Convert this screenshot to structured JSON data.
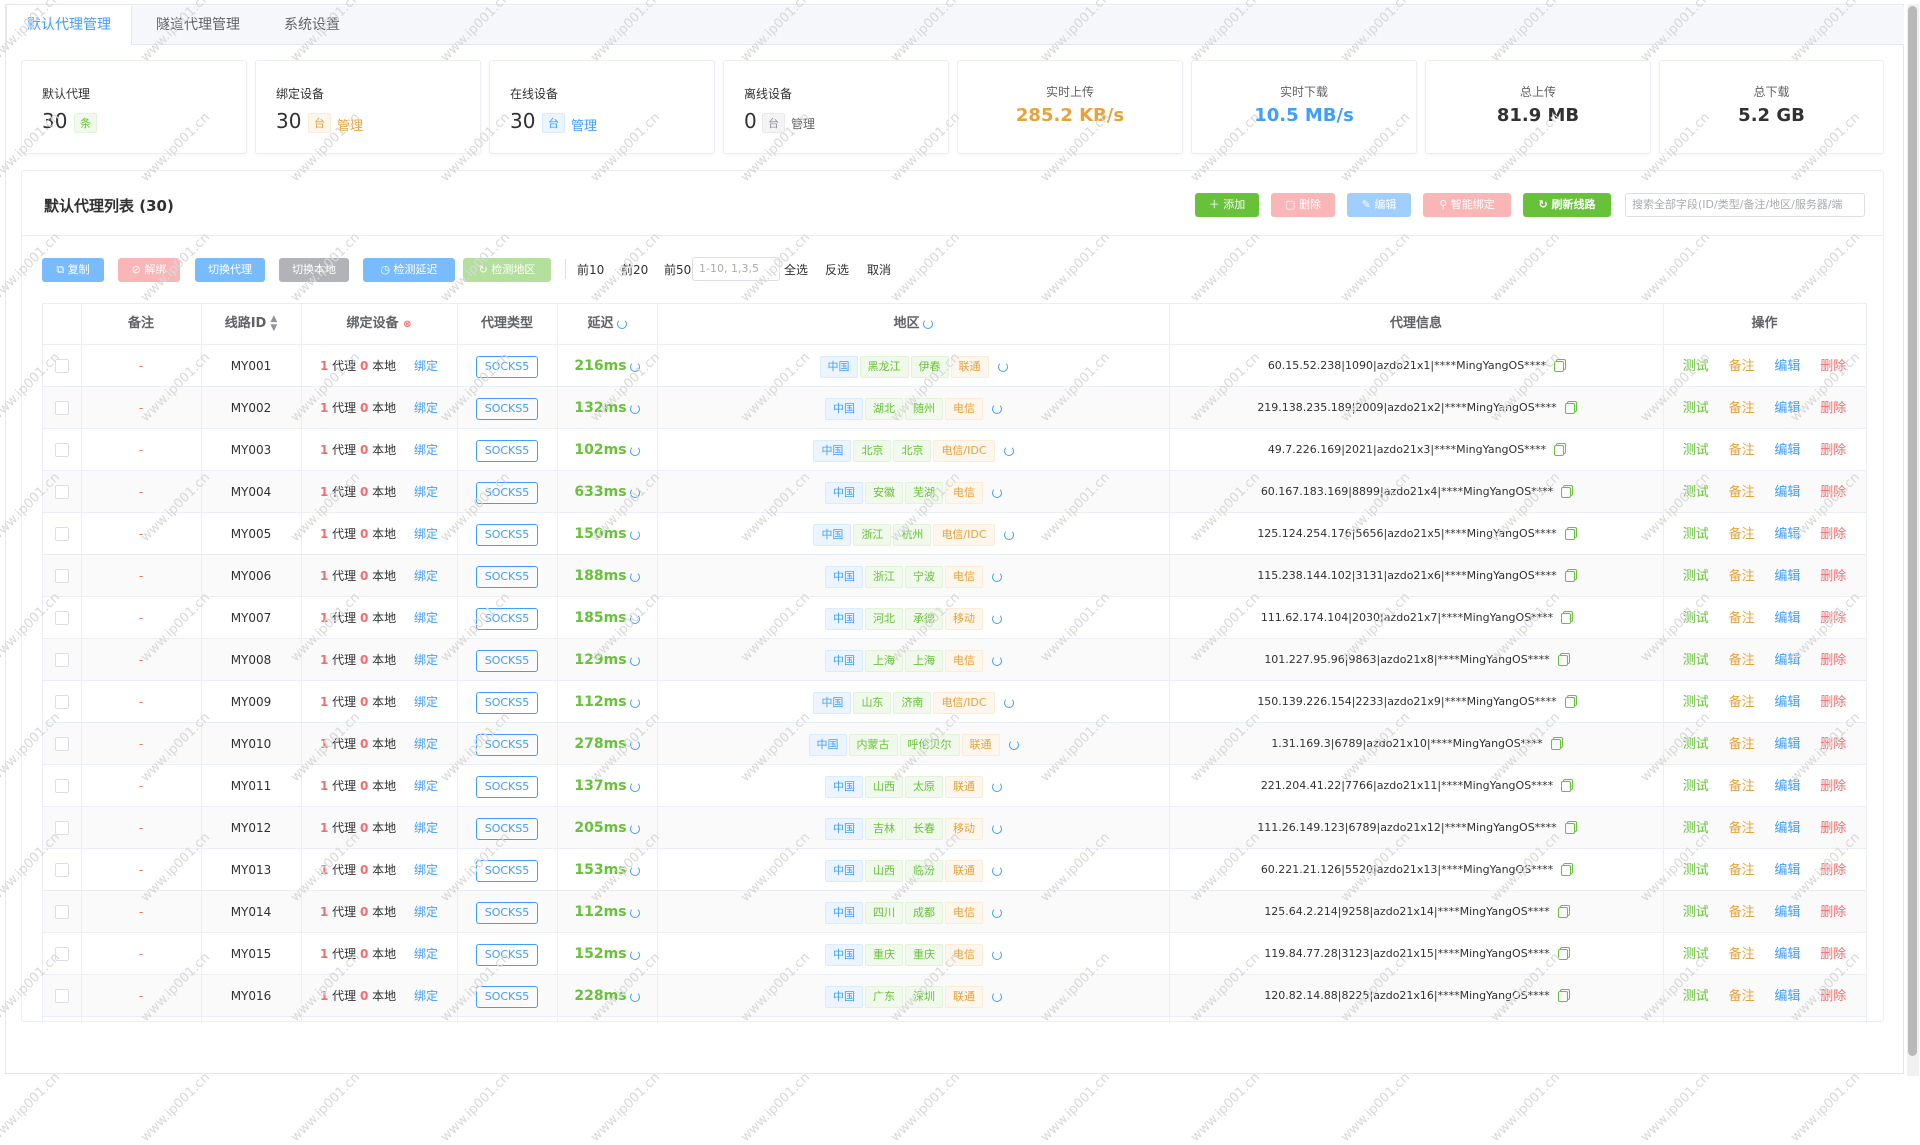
{
  "tabs": [
    "默认代理管理",
    "隧道代理管理",
    "系统设置"
  ],
  "stats": {
    "default_proxy": {
      "label": "默认代理",
      "value": "30",
      "unit": "条"
    },
    "bound_devices": {
      "label": "绑定设备",
      "value": "30",
      "unit": "台",
      "link": "管理"
    },
    "online_devices": {
      "label": "在线设备",
      "value": "30",
      "unit": "台",
      "link": "管理"
    },
    "offline_devices": {
      "label": "离线设备",
      "value": "0",
      "unit": "台",
      "link": "管理"
    },
    "upload_rate": {
      "label": "实时上传",
      "value": "285.2 KB/s",
      "color": "#e6a23c"
    },
    "download_rate": {
      "label": "实时下载",
      "value": "10.5 MB/s",
      "color": "#409eff"
    },
    "total_upload": {
      "label": "总上传",
      "value": "81.9 MB",
      "color": "#303133"
    },
    "total_download": {
      "label": "总下载",
      "value": "5.2 GB",
      "color": "#303133"
    }
  },
  "panel": {
    "title": "默认代理列表 (30)",
    "toolbar": {
      "add": "添加",
      "delete": "删除",
      "edit": "编辑",
      "smart_bind": "智能绑定",
      "refresh": "刷新线路"
    },
    "search_placeholder": "搜索全部字段(ID/类型/备注/地区/服务器/端",
    "actions": {
      "copy": "复制",
      "unbind": "解绑",
      "switch_proxy": "切换代理",
      "switch_local": "切换本地",
      "check_latency": "检测延迟",
      "check_region": "检测地区"
    },
    "quick": {
      "top10": "前10",
      "top20": "前20",
      "top50": "前50",
      "range_placeholder": "1-10, 1,3,5",
      "select_all": "全选",
      "invert": "反选",
      "cancel": "取消"
    }
  },
  "table": {
    "headers": {
      "remark": "备注",
      "line_id": "线路ID",
      "bound": "绑定设备",
      "type": "代理类型",
      "latency": "延迟",
      "region": "地区",
      "info": "代理信息",
      "ops": "操作"
    },
    "labels": {
      "proxy": "代理",
      "local": "本地",
      "bind": "绑定",
      "test": "测试",
      "note": "备注",
      "edit": "编辑",
      "delete": "删除"
    },
    "rows": [
      {
        "remark": "-",
        "id": "MY001",
        "proxy_n": "1",
        "local_n": "0",
        "type": "SOCKS5",
        "latency": "216ms",
        "region": [
          "中国",
          "黑龙江",
          "伊春",
          "联通"
        ],
        "info": "60.15.52.238|1090|azdo21x1|****MingYangOS****"
      },
      {
        "remark": "-",
        "id": "MY002",
        "proxy_n": "1",
        "local_n": "0",
        "type": "SOCKS5",
        "latency": "132ms",
        "region": [
          "中国",
          "湖北",
          "随州",
          "电信"
        ],
        "info": "219.138.235.189|2009|azdo21x2|****MingYangOS****"
      },
      {
        "remark": "-",
        "id": "MY003",
        "proxy_n": "1",
        "local_n": "0",
        "type": "SOCKS5",
        "latency": "102ms",
        "region": [
          "中国",
          "北京",
          "北京",
          "电信/IDC"
        ],
        "info": "49.7.226.169|2021|azdo21x3|****MingYangOS****"
      },
      {
        "remark": "-",
        "id": "MY004",
        "proxy_n": "1",
        "local_n": "0",
        "type": "SOCKS5",
        "latency": "633ms",
        "region": [
          "中国",
          "安徽",
          "芜湖",
          "电信"
        ],
        "info": "60.167.183.169|8899|azdo21x4|****MingYangOS****"
      },
      {
        "remark": "-",
        "id": "MY005",
        "proxy_n": "1",
        "local_n": "0",
        "type": "SOCKS5",
        "latency": "150ms",
        "region": [
          "中国",
          "浙江",
          "杭州",
          "电信/IDC"
        ],
        "info": "125.124.254.176|5656|azdo21x5|****MingYangOS****"
      },
      {
        "remark": "-",
        "id": "MY006",
        "proxy_n": "1",
        "local_n": "0",
        "type": "SOCKS5",
        "latency": "188ms",
        "region": [
          "中国",
          "浙江",
          "宁波",
          "电信"
        ],
        "info": "115.238.144.102|3131|azdo21x6|****MingYangOS****"
      },
      {
        "remark": "-",
        "id": "MY007",
        "proxy_n": "1",
        "local_n": "0",
        "type": "SOCKS5",
        "latency": "185ms",
        "region": [
          "中国",
          "河北",
          "承德",
          "移动"
        ],
        "info": "111.62.174.104|2030|azdo21x7|****MingYangOS****"
      },
      {
        "remark": "-",
        "id": "MY008",
        "proxy_n": "1",
        "local_n": "0",
        "type": "SOCKS5",
        "latency": "129ms",
        "region": [
          "中国",
          "上海",
          "上海",
          "电信"
        ],
        "info": "101.227.95.96|9863|azdo21x8|****MingYangOS****"
      },
      {
        "remark": "-",
        "id": "MY009",
        "proxy_n": "1",
        "local_n": "0",
        "type": "SOCKS5",
        "latency": "112ms",
        "region": [
          "中国",
          "山东",
          "济南",
          "电信/IDC"
        ],
        "info": "150.139.226.154|2233|azdo21x9|****MingYangOS****"
      },
      {
        "remark": "-",
        "id": "MY010",
        "proxy_n": "1",
        "local_n": "0",
        "type": "SOCKS5",
        "latency": "278ms",
        "region": [
          "中国",
          "内蒙古",
          "呼伦贝尔",
          "联通"
        ],
        "info": "1.31.169.3|6789|azdo21x10|****MingYangOS****"
      },
      {
        "remark": "-",
        "id": "MY011",
        "proxy_n": "1",
        "local_n": "0",
        "type": "SOCKS5",
        "latency": "137ms",
        "region": [
          "中国",
          "山西",
          "太原",
          "联通"
        ],
        "info": "221.204.41.22|7766|azdo21x11|****MingYangOS****"
      },
      {
        "remark": "-",
        "id": "MY012",
        "proxy_n": "1",
        "local_n": "0",
        "type": "SOCKS5",
        "latency": "205ms",
        "region": [
          "中国",
          "吉林",
          "长春",
          "移动"
        ],
        "info": "111.26.149.123|6789|azdo21x12|****MingYangOS****"
      },
      {
        "remark": "-",
        "id": "MY013",
        "proxy_n": "1",
        "local_n": "0",
        "type": "SOCKS5",
        "latency": "153ms",
        "region": [
          "中国",
          "山西",
          "临汾",
          "联通"
        ],
        "info": "60.221.21.126|5520|azdo21x13|****MingYangOS****"
      },
      {
        "remark": "-",
        "id": "MY014",
        "proxy_n": "1",
        "local_n": "0",
        "type": "SOCKS5",
        "latency": "112ms",
        "region": [
          "中国",
          "四川",
          "成都",
          "电信"
        ],
        "info": "125.64.2.214|9258|azdo21x14|****MingYangOS****"
      },
      {
        "remark": "-",
        "id": "MY015",
        "proxy_n": "1",
        "local_n": "0",
        "type": "SOCKS5",
        "latency": "152ms",
        "region": [
          "中国",
          "重庆",
          "重庆",
          "电信"
        ],
        "info": "119.84.77.28|3123|azdo21x15|****MingYangOS****"
      },
      {
        "remark": "-",
        "id": "MY016",
        "proxy_n": "1",
        "local_n": "0",
        "type": "SOCKS5",
        "latency": "228ms",
        "region": [
          "中国",
          "广东",
          "深圳",
          "联通"
        ],
        "info": "120.82.14.88|8225|azdo21x16|****MingYangOS****"
      }
    ]
  },
  "watermark": "www.ip001.cn",
  "colors": {
    "primary": "#409eff",
    "success": "#67c23a",
    "warning": "#e6a23c",
    "danger": "#f56c6c"
  }
}
